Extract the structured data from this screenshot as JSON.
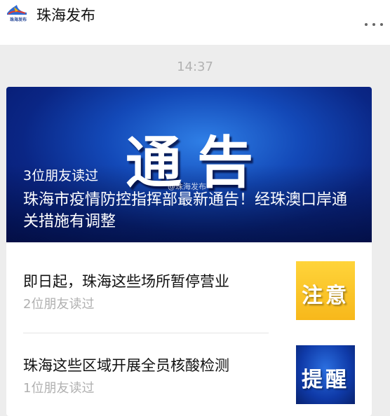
{
  "header": {
    "account_name": "珠海发布",
    "logo_text": "珠海发布",
    "more_icon": "more-dots-icon"
  },
  "timestamp": "14:37",
  "hero": {
    "image_text": "通告",
    "watermark": "@珠海发布",
    "readers": "3位朋友读过",
    "title": "珠海市疫情防控指挥部最新通告！经珠澳口岸通关措施有调整"
  },
  "articles": [
    {
      "title": "即日起，珠海这些场所暂停营业",
      "readers": "2位朋友读过",
      "thumb_text": "注意"
    },
    {
      "title": "珠海这些区域开展全员核酸检测",
      "readers": "1位朋友读过",
      "thumb_text": "提醒"
    }
  ]
}
